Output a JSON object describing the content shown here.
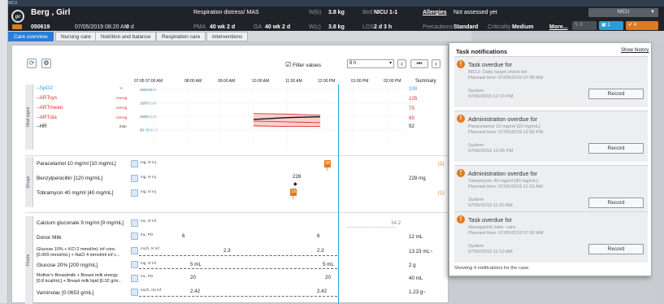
{
  "window": {
    "tab1": "NICU"
  },
  "header": {
    "patient_name": "Berg , Girl",
    "patient_id": "050619",
    "dob": "07/05/2019 08:20 AM",
    "age": "0 d",
    "diagnosis": "Respiration distress/ MAS",
    "pma_label": "PMA",
    "pma_value": "40 wk 2 d",
    "ga_label": "GA",
    "ga_value": "40 wk 2 d",
    "weight_label": "W(b)",
    "weight_value": "3.8 kg",
    "weight2_label": "W(c)",
    "weight2_value": "3.8 kg",
    "bed_label": "Bed",
    "bed_value": "NICU 1-1",
    "los_label": "LOS",
    "los_value": "2 d 3 h",
    "allergies": "Allergies",
    "allergy_status": "Not assessed yet",
    "precautions_label": "Precautions",
    "precautions_value": "Standard",
    "criticality_label": "Criticality",
    "criticality_value": "Medium",
    "more": "More...",
    "unit_select": "NICU",
    "pill_notes": "0",
    "pill_info": "1",
    "pill_tasks": "4"
  },
  "tabs": [
    "Care overview",
    "Nursing care",
    "Nutrition and balance",
    "Respiration care",
    "Interventions"
  ],
  "toolbar": {
    "filter_label": "Filter values",
    "range": "8 h",
    "summary": "Summary"
  },
  "times": [
    "07:05 07:00 AM",
    "08:00 AM",
    "09:00 AM",
    "10:00 AM",
    "11:00 AM",
    "12:00 PM",
    "01:00 PM",
    "02:00 PM"
  ],
  "chart_data": {
    "type": "line",
    "title": "",
    "xlabel": "",
    "ylabel": "",
    "x": [
      "07:00 AM",
      "08:00 AM",
      "09:00 AM",
      "10:00 AM",
      "11:00 AM",
      "12:00 PM",
      "01:00 PM",
      "02:00 PM"
    ],
    "series": [
      {
        "name": "SpO2",
        "values": [
          null,
          null,
          null,
          null,
          null,
          null,
          null,
          null
        ],
        "summary": "100",
        "unit": "%"
      },
      {
        "name": "ARTsys",
        "values": [
          null,
          null,
          null,
          110,
          108,
          104,
          null,
          null
        ],
        "summary": "105",
        "unit": "mmHg"
      },
      {
        "name": "ARTmean",
        "values": [
          null,
          null,
          null,
          82,
          79,
          76,
          null,
          null
        ],
        "summary": "75",
        "unit": "mmHg"
      },
      {
        "name": "ARTdia",
        "values": [
          null,
          null,
          null,
          64,
          62,
          62,
          null,
          null
        ],
        "summary": "65",
        "unit": "mmHg"
      },
      {
        "name": "HR",
        "values": [
          null,
          null,
          null,
          88,
          95,
          98,
          null,
          null
        ],
        "summary": "92",
        "unit": "/min"
      }
    ],
    "yticks_left": [
      "200",
      "150",
      "100",
      "50"
    ],
    "yticks_mid": [
      "100",
      "75",
      "50",
      "25"
    ],
    "yticks_right": [
      "280",
      "180",
      "125",
      "62.5"
    ]
  },
  "sections": {
    "vital": "Vital signs",
    "drugs": "Drugs",
    "fluids": "Fluids"
  },
  "drugs": [
    {
      "name": "Paracetamol 10 mg/ml [10 mg/mL]",
      "route": "mg, IV inj",
      "badge": "38",
      "badge_sub": "9",
      "summary": "(1)"
    },
    {
      "name": "Benzylpenicillin [120 mg/mL]",
      "route": "mg, IV inj",
      "value": "228",
      "summary": "228 mg"
    },
    {
      "name": "Tobramycin 40 mg/ml [40 mg/mL]",
      "route": "mg, IV inj",
      "badge": "19",
      "badge_sub": "9",
      "summary": "(1)"
    }
  ],
  "fluids": [
    {
      "name": "Calcium gluconate 9 mg/ml [9 mg/mL]",
      "route": "mL, IV inf",
      "value": "34.2",
      "summary": ""
    },
    {
      "name": "Donor Milk",
      "route": "mL, PO",
      "v1": "6",
      "v2": "6",
      "summary": "12 mL"
    },
    {
      "name": "Glucose 10% + KCl 2 mmol/mL inf conc [0.009 mmol/mL] + NaCl 4 mmol/ml inf c...",
      "route": "mL/h, IV inf",
      "v1": "2.3",
      "v2": "2.3",
      "summary": "13.23 mL~"
    },
    {
      "name": "Glucose 20% [200 mg/mL]",
      "route": "mg, IV inf",
      "v1": "5 mL",
      "v2": "5 mL",
      "summary": "2 g"
    },
    {
      "name": "Mother's Breastmilk + Breast milk energy [0.8 kcal/mL] + Breast milk lipid [0.02 g/m...",
      "route": "mL, PO",
      "v1": "20",
      "v2": "20",
      "summary": "40 mL"
    },
    {
      "name": "Vaminolac [0.0653 g/mL]",
      "route": "mL/h, cIV inf",
      "v1": "2.42",
      "v2": "2.42",
      "summary": "1.23 g~"
    }
  ],
  "notifications": {
    "title": "Task notifications",
    "show_history": "Show history",
    "record_label": "Record",
    "footer": "Showing 4 notifications for the case.",
    "items": [
      {
        "title": "Task overdue for",
        "line1": "NICU- Daily target check list",
        "line2": "Planned time: 07/05/2019 07:00 AM",
        "src": "System",
        "time": "07/05/2019 12:19 PM"
      },
      {
        "title": "Administration overdue for",
        "line1": "Paracetamol 10 mg/ml [10 mg/mL]",
        "line2": "Planned time: 07/05/2019 12:00 PM",
        "src": "System",
        "time": "07/05/2019 12:05 PM"
      },
      {
        "title": "Administration overdue for",
        "line1": "Tobramycin 40 mg/ml [40 mg/mL]",
        "line2": "Planned time: 07/05/2019 11:15 AM",
        "src": "System",
        "time": "07/05/2019 11:20 AM"
      },
      {
        "title": "Task overdue for",
        "line1": "Nasogastric tube- care",
        "line2": "Planned time: 07/05/2019 07:50 AM",
        "src": "System",
        "time": "07/05/2019 11:10 AM"
      }
    ]
  },
  "colors": {
    "accent": "#2a7fd4",
    "orange": "#e07a1e",
    "art": "#e03030",
    "hr": "#111111",
    "spo2": "#2a9fd6"
  }
}
